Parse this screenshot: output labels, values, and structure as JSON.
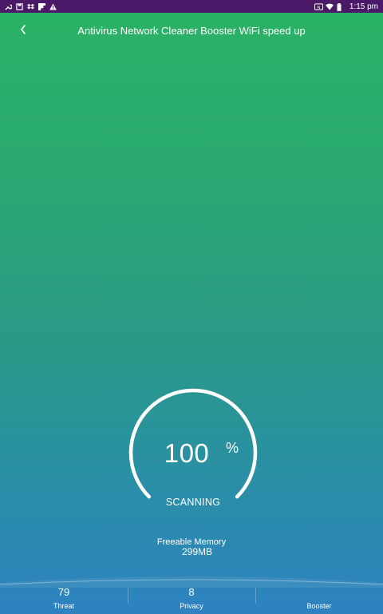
{
  "status_bar": {
    "time": "1:15 pm",
    "left_icons": [
      "wrench-icon",
      "save-icon",
      "dropbox-icon",
      "flipboard-icon",
      "warning-icon"
    ],
    "right_icons": [
      "nfc-icon",
      "wifi-icon",
      "battery-icon"
    ],
    "background": "#4c1868"
  },
  "header": {
    "title": "Antivirus Network Cleaner Booster WiFi speed up"
  },
  "gauge": {
    "value": "100",
    "unit": "%",
    "status": "SCANNING",
    "progress": 1.0
  },
  "memory": {
    "label": "Freeable Memory",
    "value": "299MB"
  },
  "bottom_nav": [
    {
      "count": "79",
      "label": "Threat"
    },
    {
      "count": "8",
      "label": "Privacy"
    },
    {
      "count": "",
      "label": "Booster"
    }
  ],
  "colors": {
    "gradient_top": "#2ab364",
    "gradient_bottom": "#2e82c0",
    "foreground": "#ffffff"
  }
}
